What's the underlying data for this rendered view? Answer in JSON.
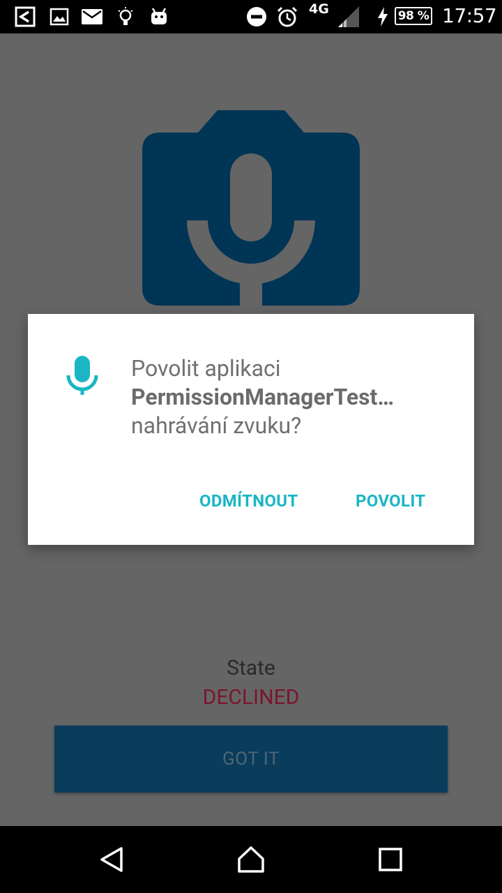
{
  "status_bar": {
    "icons": [
      "screen-mirror-icon",
      "image-icon",
      "mail-icon",
      "bulb-icon",
      "android-icon",
      "do-not-disturb-icon",
      "alarm-icon",
      "signal-icon",
      "charging-icon"
    ],
    "network": "4G",
    "battery": "98 %",
    "time": "17:57"
  },
  "app": {
    "hero_icon": "microphone-camera-icon",
    "state_label": "State",
    "state_value": "DECLINED",
    "got_it_label": "GOT IT",
    "colors": {
      "primary": "#0a3c5c",
      "declined": "#7a1530"
    }
  },
  "dialog": {
    "icon": "microphone-icon",
    "line1": "Povolit aplikaci",
    "app_name": "PermissionManagerTest…",
    "line3": "nahrávání zvuku?",
    "deny_label": "ODMÍTNOUT",
    "allow_label": "POVOLIT",
    "accent": "#1ab6c4"
  },
  "nav_bar": {
    "back": "back-icon",
    "home": "home-icon",
    "recents": "recents-icon"
  }
}
